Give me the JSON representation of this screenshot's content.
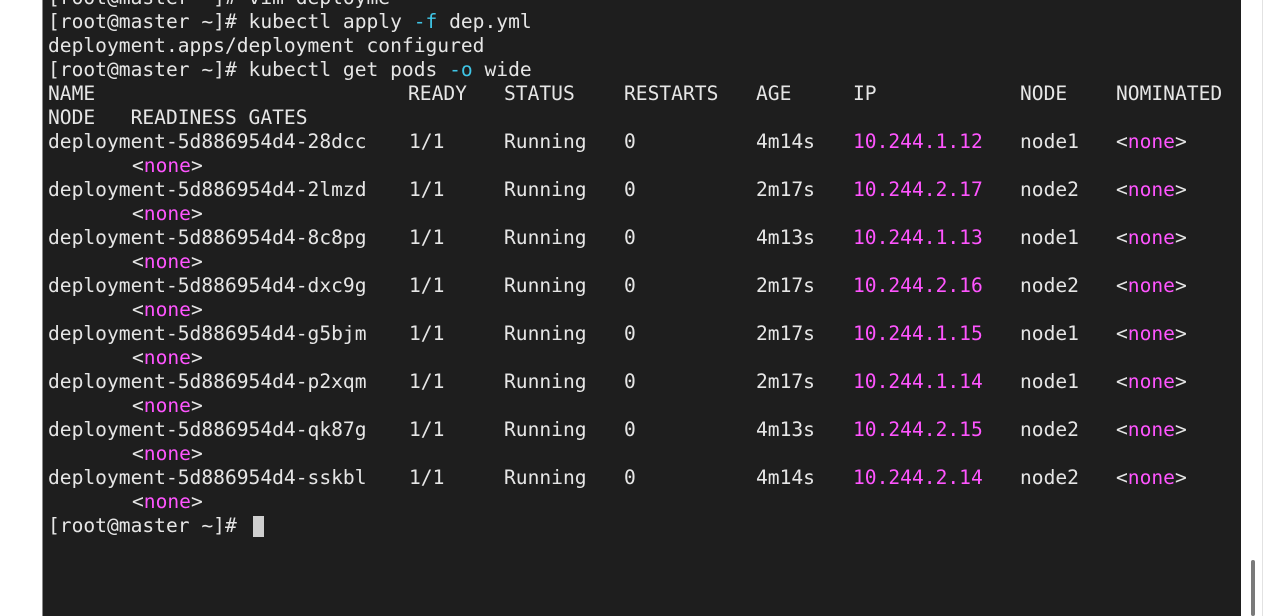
{
  "terminal": {
    "partial_top_line": "[root@master ~]# vim deployme",
    "cmd_apply": {
      "prompt": "[root@master ~]# ",
      "command": "kubectl apply ",
      "flag": "-f",
      "arg": " dep.yml"
    },
    "apply_output": "deployment.apps/deployment configured",
    "cmd_get": {
      "prompt": "[root@master ~]# ",
      "command": "kubectl get pods ",
      "flag": "-o",
      "arg": " wide"
    },
    "columns": {
      "name": "NAME",
      "ready": "READY",
      "status": "STATUS",
      "restarts": "RESTARTS",
      "age": "AGE",
      "ip": "IP",
      "node": "NODE",
      "nominated": "NOMINATED",
      "header_wrap": "NODE   READINESS GATES"
    },
    "pods": [
      {
        "name": "deployment-5d886954d4-28dcc",
        "ready": "1/1",
        "status": "Running",
        "restarts": "0",
        "age": "4m14s",
        "ip": "10.244.1.12",
        "node": "node1",
        "nominated_open": "<",
        "nominated_val": "none",
        "nominated_close": ">",
        "readiness_open": "<",
        "readiness_val": "none",
        "readiness_close": ">"
      },
      {
        "name": "deployment-5d886954d4-2lmzd",
        "ready": "1/1",
        "status": "Running",
        "restarts": "0",
        "age": "2m17s",
        "ip": "10.244.2.17",
        "node": "node2",
        "nominated_open": "<",
        "nominated_val": "none",
        "nominated_close": ">",
        "readiness_open": "<",
        "readiness_val": "none",
        "readiness_close": ">"
      },
      {
        "name": "deployment-5d886954d4-8c8pg",
        "ready": "1/1",
        "status": "Running",
        "restarts": "0",
        "age": "4m13s",
        "ip": "10.244.1.13",
        "node": "node1",
        "nominated_open": "<",
        "nominated_val": "none",
        "nominated_close": ">",
        "readiness_open": "<",
        "readiness_val": "none",
        "readiness_close": ">"
      },
      {
        "name": "deployment-5d886954d4-dxc9g",
        "ready": "1/1",
        "status": "Running",
        "restarts": "0",
        "age": "2m17s",
        "ip": "10.244.2.16",
        "node": "node2",
        "nominated_open": "<",
        "nominated_val": "none",
        "nominated_close": ">",
        "readiness_open": "<",
        "readiness_val": "none",
        "readiness_close": ">"
      },
      {
        "name": "deployment-5d886954d4-g5bjm",
        "ready": "1/1",
        "status": "Running",
        "restarts": "0",
        "age": "2m17s",
        "ip": "10.244.1.15",
        "node": "node1",
        "nominated_open": "<",
        "nominated_val": "none",
        "nominated_close": ">",
        "readiness_open": "<",
        "readiness_val": "none",
        "readiness_close": ">"
      },
      {
        "name": "deployment-5d886954d4-p2xqm",
        "ready": "1/1",
        "status": "Running",
        "restarts": "0",
        "age": "2m17s",
        "ip": "10.244.1.14",
        "node": "node1",
        "nominated_open": "<",
        "nominated_val": "none",
        "nominated_close": ">",
        "readiness_open": "<",
        "readiness_val": "none",
        "readiness_close": ">"
      },
      {
        "name": "deployment-5d886954d4-qk87g",
        "ready": "1/1",
        "status": "Running",
        "restarts": "0",
        "age": "4m13s",
        "ip": "10.244.2.15",
        "node": "node2",
        "nominated_open": "<",
        "nominated_val": "none",
        "nominated_close": ">",
        "readiness_open": "<",
        "readiness_val": "none",
        "readiness_close": ">"
      },
      {
        "name": "deployment-5d886954d4-sskbl",
        "ready": "1/1",
        "status": "Running",
        "restarts": "0",
        "age": "4m14s",
        "ip": "10.244.2.14",
        "node": "node2",
        "nominated_open": "<",
        "nominated_val": "none",
        "nominated_close": ">",
        "readiness_open": "<",
        "readiness_val": "none",
        "readiness_close": ">"
      }
    ],
    "final_prompt": "[root@master ~]# "
  },
  "colors": {
    "background": "#1e1e1e",
    "foreground": "#e6e6e6",
    "flag": "#3fc5e6",
    "ip": "#ff55ff",
    "none_value": "#ff55ff"
  }
}
